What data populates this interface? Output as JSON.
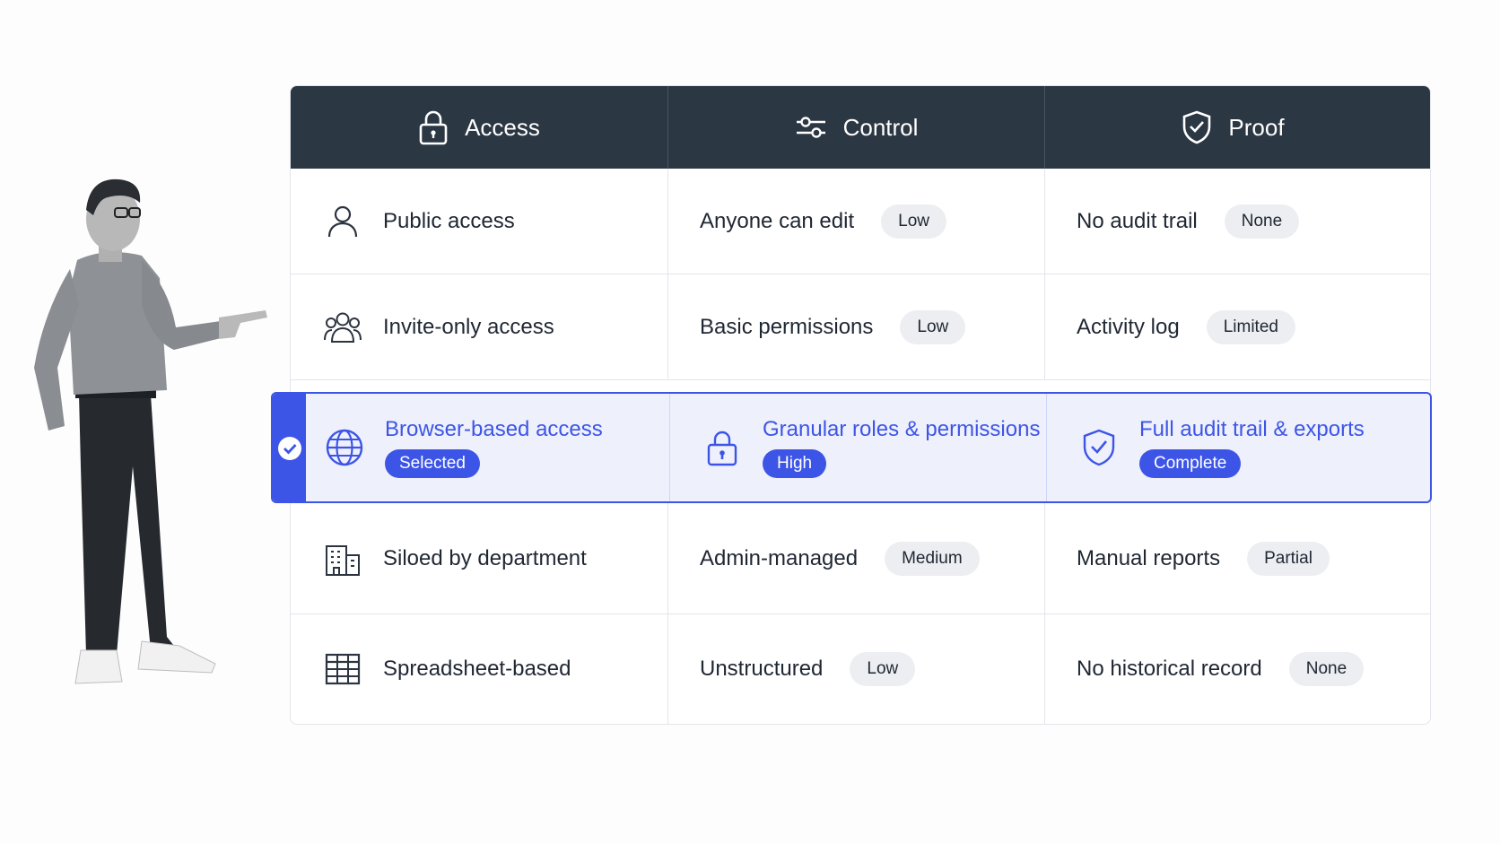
{
  "header": {
    "columns": [
      {
        "label": "Access",
        "icon": "lock-icon"
      },
      {
        "label": "Control",
        "icon": "sliders-icon"
      },
      {
        "label": "Proof",
        "icon": "shield-check-icon"
      }
    ]
  },
  "rows": [
    {
      "access": "Public access",
      "icon": "user-icon",
      "control": "Anyone can edit",
      "control_level": "Low",
      "proof": "No audit trail",
      "proof_level": "None"
    },
    {
      "access": "Invite-only access",
      "icon": "users-group-icon",
      "control": "Basic permissions",
      "control_level": "Low",
      "proof": "Activity log",
      "proof_level": "Limited"
    },
    {
      "access": "Browser-based access",
      "icon": "globe-icon",
      "access_badge": "Selected",
      "control": "Granular roles & permissions",
      "control_level": "High",
      "proof": "Full audit trail & exports",
      "proof_level": "Complete",
      "selected": true
    },
    {
      "access": "Siloed by department",
      "icon": "building-icon",
      "control": "Admin-managed",
      "control_level": "Medium",
      "proof": "Manual reports",
      "proof_level": "Partial"
    },
    {
      "access": "Spreadsheet-based",
      "icon": "spreadsheet-icon",
      "control": "Unstructured",
      "control_level": "Low",
      "proof": "No historical record",
      "proof_level": "None"
    }
  ],
  "colors": {
    "header_bg": "#2c3744",
    "accent": "#3d55e6",
    "selected_bg": "#eef0fc",
    "pill_bg": "#eceef1"
  }
}
